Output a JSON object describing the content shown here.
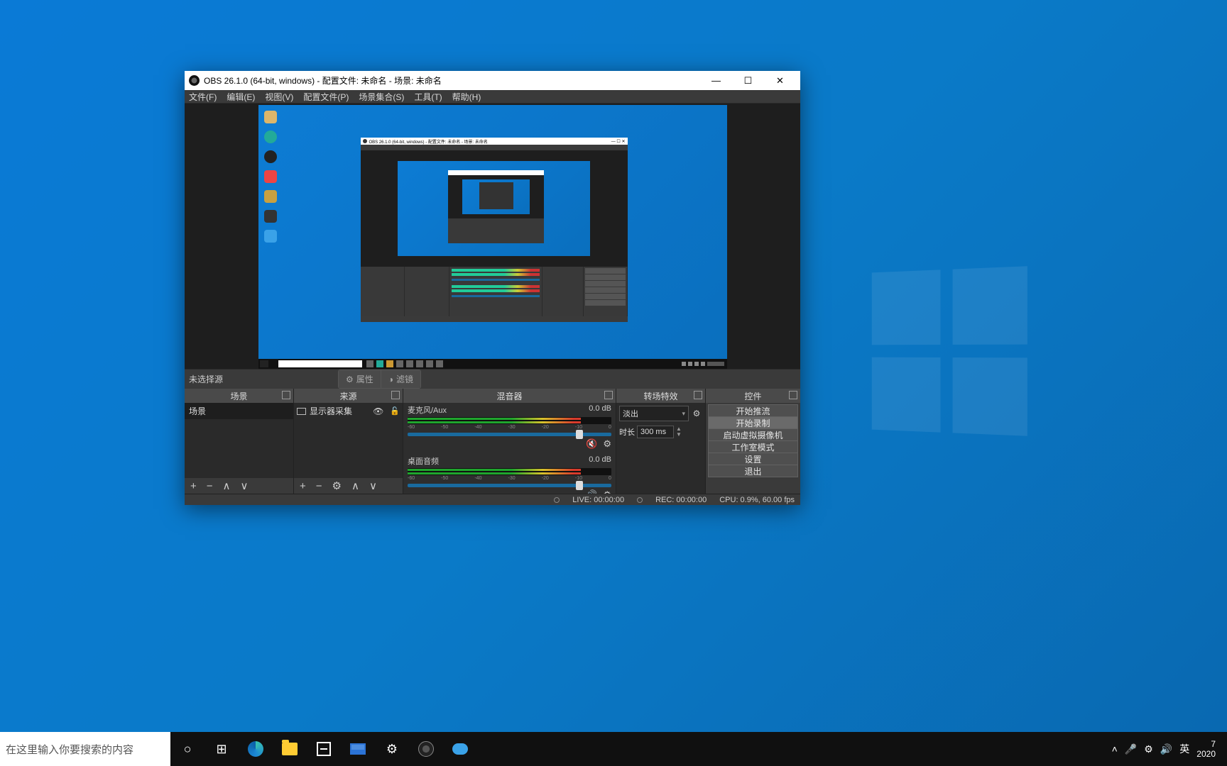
{
  "desktop": {},
  "taskbar": {
    "search_placeholder": "在这里输入你要搜索的内容",
    "tray_ime": "英",
    "tray_time": "7",
    "tray_date": "2020"
  },
  "obs": {
    "title": "OBS 26.1.0 (64-bit, windows) - 配置文件: 未命名 - 场景: 未命名",
    "menu": [
      "文件(F)",
      "编辑(E)",
      "视图(V)",
      "配置文件(P)",
      "场景集合(S)",
      "工具(T)",
      "帮助(H)"
    ],
    "no_source_selected": "未选择源",
    "btn_properties": "属性",
    "btn_filters": "滤镜",
    "docks": {
      "scenes": {
        "title": "场景",
        "items": [
          "场景"
        ]
      },
      "sources": {
        "title": "来源",
        "items": [
          {
            "label": "显示器采集"
          }
        ]
      },
      "mixer": {
        "title": "混音器",
        "channels": [
          {
            "name": "麦克风/Aux",
            "db": "0.0 dB",
            "muted": true
          },
          {
            "name": "桌面音频",
            "db": "0.0 dB",
            "muted": false
          }
        ]
      },
      "transitions": {
        "title": "转场特效",
        "selected": "淡出",
        "duration_label": "时长",
        "duration_value": "300 ms"
      },
      "controls": {
        "title": "控件",
        "buttons": [
          "开始推流",
          "开始录制",
          "启动虚拟摄像机",
          "工作室模式",
          "设置",
          "退出"
        ]
      }
    },
    "status": {
      "live": "LIVE: 00:00:00",
      "rec": "REC: 00:00:00",
      "cpu": "CPU: 0.9%, 60.00 fps"
    }
  }
}
